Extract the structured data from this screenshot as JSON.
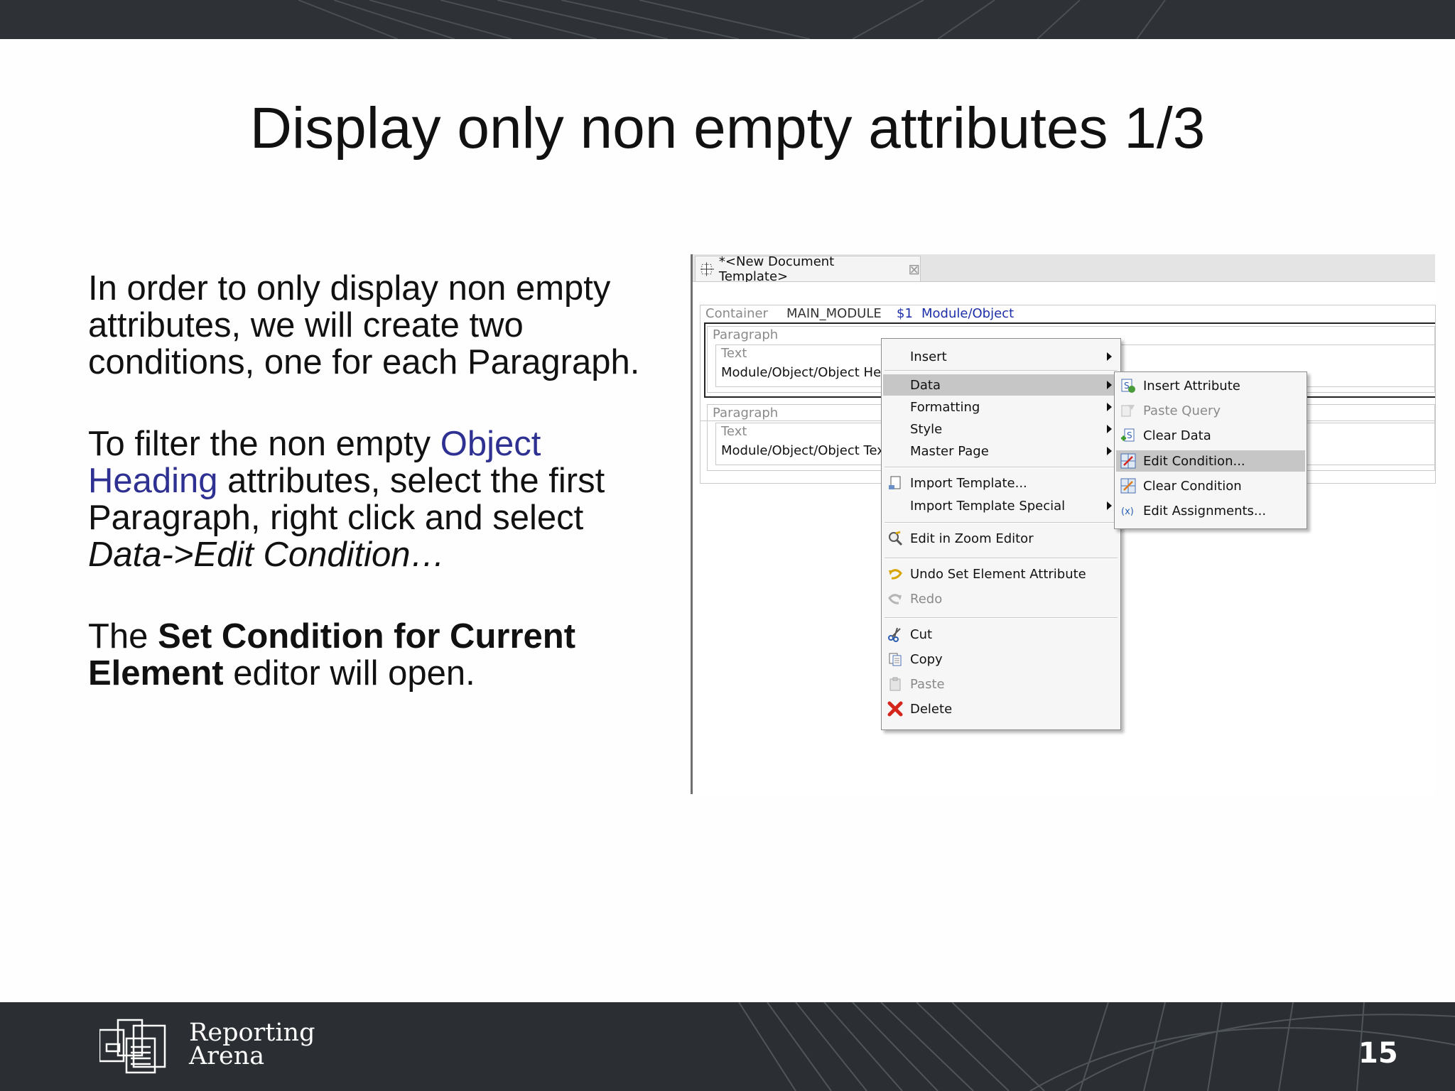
{
  "slide": {
    "title": "Display only non empty attributes 1/3",
    "page_number": "15"
  },
  "body": {
    "p1": "In order to only display non empty attributes, we will create two conditions, one for each Paragraph.",
    "p2_pre": "To filter the non empty ",
    "p2_highlight": "Object Heading",
    "p2_mid": " attributes, select the first Paragraph, right click and select ",
    "p2_italic": "Data->Edit Condition…",
    "p3_pre": "The ",
    "p3_bold": "Set Condition for Current Element",
    "p3_post": " editor will open."
  },
  "logo": {
    "line1": "Reporting",
    "line2": "Arena"
  },
  "editor": {
    "tab_title": "*<New Document Template>",
    "container_label": "Container",
    "container_name": "MAIN_MODULE",
    "container_var": "$1",
    "container_path": "Module/Object",
    "paragraph1": {
      "label": "Paragraph",
      "text_label": "Text",
      "text_value": "Module/Object/Object Hea"
    },
    "paragraph2": {
      "label": "Paragraph",
      "text_label": "Text",
      "text_value": "Module/Object/Object Tex"
    }
  },
  "context_menu": {
    "insert": "Insert",
    "data": "Data",
    "formatting": "Formatting",
    "style": "Style",
    "master_page": "Master Page",
    "import_template": "Import Template...",
    "import_template_special": "Import Template Special",
    "edit_zoom": "Edit in Zoom Editor",
    "undo": "Undo Set Element Attribute",
    "redo": "Redo",
    "cut": "Cut",
    "copy": "Copy",
    "paste": "Paste",
    "delete": "Delete"
  },
  "data_submenu": {
    "insert_attribute": "Insert Attribute",
    "paste_query": "Paste Query",
    "clear_data": "Clear Data",
    "edit_condition": "Edit Condition...",
    "clear_condition": "Clear Condition",
    "edit_assignments": "Edit Assignments..."
  },
  "colors": {
    "band": "#2e3236",
    "highlight_text": "#2e3192",
    "menu_selected": "#c6c6c6",
    "link_blue": "#1d2fa8"
  }
}
